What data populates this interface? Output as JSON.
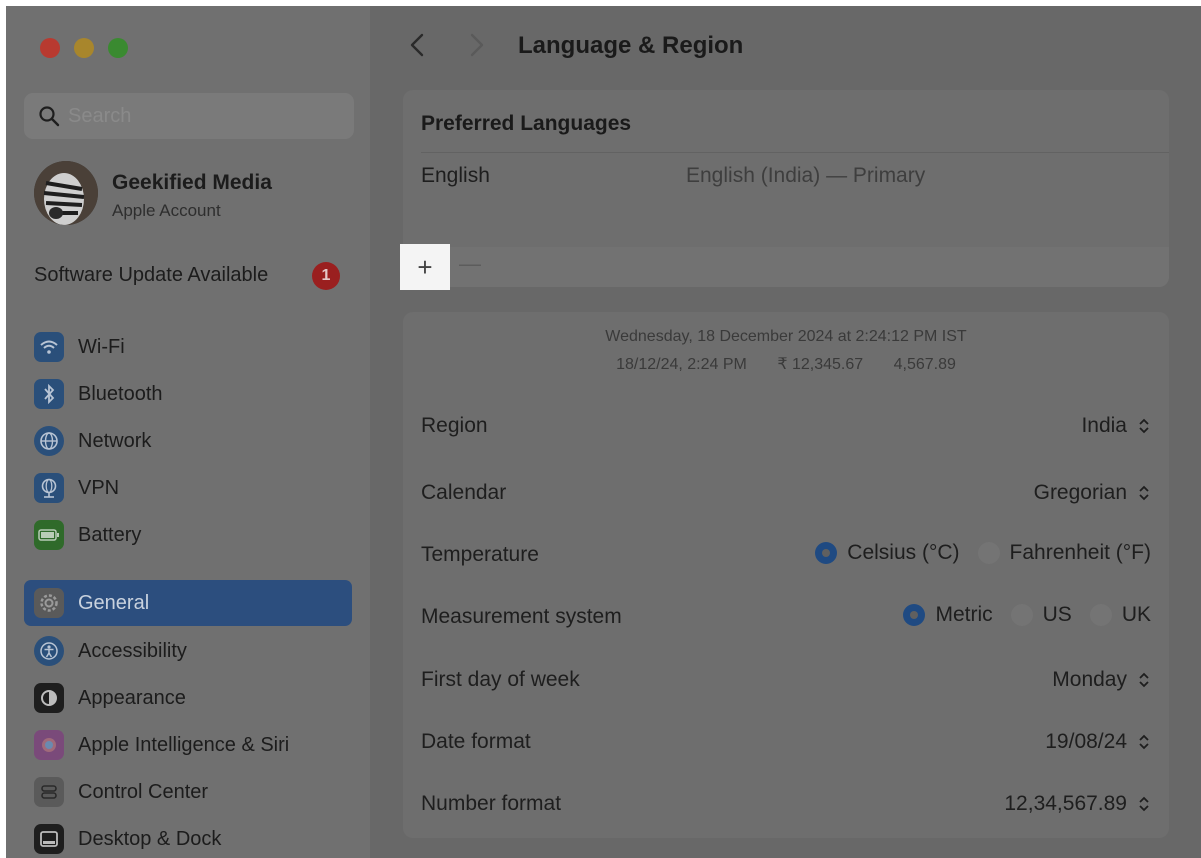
{
  "sidebar": {
    "search_placeholder": "Search",
    "account": {
      "name": "Geekified Media",
      "subtitle": "Apple Account"
    },
    "update": {
      "label": "Software Update Available",
      "badge": "1"
    },
    "items": [
      {
        "label": "Wi-Fi",
        "icon": "wifi-icon",
        "color": "#2a4f7a"
      },
      {
        "label": "Bluetooth",
        "icon": "bluetooth-icon",
        "color": "#2a4f7a"
      },
      {
        "label": "Network",
        "icon": "globe-icon",
        "color": "#2a4f7a"
      },
      {
        "label": "VPN",
        "icon": "vpn-globe-icon",
        "color": "#2a4f7a"
      },
      {
        "label": "Battery",
        "icon": "battery-icon",
        "color": "#2f6a2a"
      },
      {
        "label": "General",
        "icon": "gear-icon",
        "color": "#5a5a5a"
      },
      {
        "label": "Accessibility",
        "icon": "accessibility-icon",
        "color": "#2a4f7a"
      },
      {
        "label": "Appearance",
        "icon": "appearance-icon",
        "color": "#1e1e1e"
      },
      {
        "label": "Apple Intelligence & Siri",
        "icon": "siri-icon",
        "color": "#7a4a7a"
      },
      {
        "label": "Control Center",
        "icon": "control-center-icon",
        "color": "#5a5a5a"
      },
      {
        "label": "Desktop & Dock",
        "icon": "dock-icon",
        "color": "#1e1e1e"
      }
    ],
    "selected": "General"
  },
  "header": {
    "title": "Language & Region"
  },
  "preferred_languages": {
    "title": "Preferred Languages",
    "languages": [
      {
        "name": "English",
        "description": "English (India) — Primary"
      }
    ],
    "add_label": "+",
    "remove_label": "—"
  },
  "preview": {
    "line1": "Wednesday, 18 December 2024 at 2:24:12 PM IST",
    "date": "18/12/24, 2:24 PM",
    "currency": "₹ 12,345.67",
    "number": "4,567.89"
  },
  "settings": {
    "region": {
      "label": "Region",
      "value": "India"
    },
    "calendar": {
      "label": "Calendar",
      "value": "Gregorian"
    },
    "temperature": {
      "label": "Temperature",
      "options": [
        "Celsius (°C)",
        "Fahrenheit (°F)"
      ],
      "selected": "Celsius (°C)"
    },
    "measurement": {
      "label": "Measurement system",
      "options": [
        "Metric",
        "US",
        "UK"
      ],
      "selected": "Metric"
    },
    "first_day": {
      "label": "First day of week",
      "value": "Monday"
    },
    "date_format": {
      "label": "Date format",
      "value": "19/08/24"
    },
    "number_format": {
      "label": "Number format",
      "value": "12,34,567.89"
    }
  }
}
